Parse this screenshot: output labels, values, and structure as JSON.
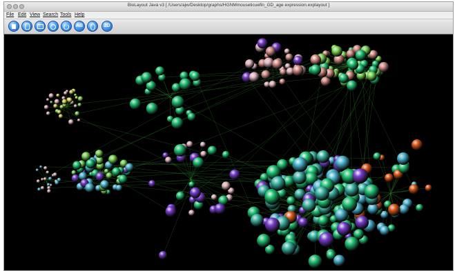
{
  "window": {
    "title": "BioLayout Java v3  [ /Users/ajw/Desktop/graphs/HGNMmouseticuefin_GD_age expression.explayout ]"
  },
  "menu": [
    {
      "label": "File"
    },
    {
      "label": "Edit"
    },
    {
      "label": "View"
    },
    {
      "label": "Search"
    },
    {
      "label": "Tools"
    },
    {
      "label": "Help"
    }
  ],
  "toolbar": {
    "buttons": [
      {
        "icon": "new-document-icon",
        "text": ""
      },
      {
        "icon": "open-file-icon",
        "text": ""
      },
      {
        "icon": "save-icon",
        "text": ""
      },
      {
        "icon": "layout-icon",
        "text": ""
      },
      {
        "icon": "redo-layout-icon",
        "text": ""
      },
      {
        "icon": "alphabet-icon",
        "text": "AB"
      },
      {
        "icon": "node-icon",
        "text": ""
      },
      {
        "icon": "view-2d-icon",
        "text": "2D"
      }
    ]
  },
  "colors": {
    "background": "#000000",
    "edge": "#2f7a2a",
    "green_node": "#22c777",
    "purple_node": "#7a3fd0",
    "pink_node": "#e7b7c2",
    "orange_node": "#e45a1c",
    "cyan_node": "#4fb9d6"
  }
}
